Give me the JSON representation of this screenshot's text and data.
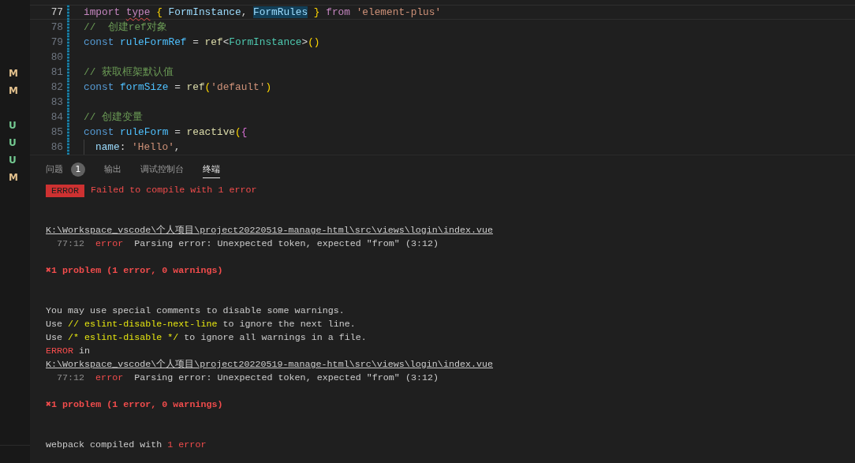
{
  "explorer": {
    "rows": [
      {
        "kind": "modified",
        "letter": "M"
      },
      {
        "kind": "modified",
        "letter": "M"
      },
      {
        "kind": "clean"
      },
      {
        "kind": "untracked",
        "letter": "U"
      },
      {
        "kind": "untracked",
        "letter": "U"
      },
      {
        "kind": "untracked",
        "letter": "U"
      },
      {
        "kind": "modified",
        "letter": "M"
      }
    ]
  },
  "editor": {
    "lines": [
      {
        "number": "77",
        "current": true,
        "changed": true,
        "tokens": [
          {
            "text": "import ",
            "kind": "keyword",
            "squiggle": false,
            "selected": false
          },
          {
            "text": "type",
            "kind": "keyword",
            "squiggle": true,
            "selected": false
          },
          {
            "text": " { ",
            "kind": "bracket",
            "squiggle": false,
            "selected": false
          },
          {
            "text": "FormInstance",
            "kind": "property",
            "squiggle": false,
            "selected": false
          },
          {
            "text": ", ",
            "kind": "plain",
            "squiggle": false,
            "selected": false
          },
          {
            "text": "FormRules",
            "kind": "property",
            "squiggle": false,
            "selected": true
          },
          {
            "text": " } ",
            "kind": "bracket",
            "squiggle": false,
            "selected": false
          },
          {
            "text": "from ",
            "kind": "keyword",
            "squiggle": false,
            "selected": false
          },
          {
            "text": "'element-plus'",
            "kind": "string",
            "squiggle": false,
            "selected": false
          }
        ]
      },
      {
        "number": "78",
        "current": false,
        "changed": true,
        "tokens": [
          {
            "text": "//  创建ref对象",
            "kind": "comment"
          }
        ]
      },
      {
        "number": "79",
        "current": false,
        "changed": true,
        "tokens": [
          {
            "text": "const ",
            "kind": "storage"
          },
          {
            "text": "ruleFormRef",
            "kind": "variable"
          },
          {
            "text": " = ",
            "kind": "plain"
          },
          {
            "text": "ref",
            "kind": "function"
          },
          {
            "text": "<",
            "kind": "plain"
          },
          {
            "text": "FormInstance",
            "kind": "type"
          },
          {
            "text": ">",
            "kind": "plain"
          },
          {
            "text": "()",
            "kind": "bracket"
          }
        ]
      },
      {
        "number": "80",
        "current": false,
        "changed": true
      },
      {
        "number": "81",
        "current": false,
        "changed": true,
        "tokens": [
          {
            "text": "// 获取框架默认值",
            "kind": "comment"
          }
        ]
      },
      {
        "number": "82",
        "current": false,
        "changed": true,
        "tokens": [
          {
            "text": "const ",
            "kind": "storage"
          },
          {
            "text": "formSize",
            "kind": "variable"
          },
          {
            "text": " = ",
            "kind": "plain"
          },
          {
            "text": "ref",
            "kind": "function"
          },
          {
            "text": "(",
            "kind": "bracket"
          },
          {
            "text": "'default'",
            "kind": "string"
          },
          {
            "text": ")",
            "kind": "bracket"
          }
        ]
      },
      {
        "number": "83",
        "current": false,
        "changed": true
      },
      {
        "number": "84",
        "current": false,
        "changed": true,
        "tokens": [
          {
            "text": "// 创建变量",
            "kind": "comment"
          }
        ]
      },
      {
        "number": "85",
        "current": false,
        "changed": true,
        "tokens": [
          {
            "text": "const ",
            "kind": "storage"
          },
          {
            "text": "ruleForm",
            "kind": "variable"
          },
          {
            "text": " = ",
            "kind": "plain"
          },
          {
            "text": "reactive",
            "kind": "function"
          },
          {
            "text": "(",
            "kind": "bracket"
          },
          {
            "text": "{",
            "kind": "bracket-nested"
          }
        ],
        "children": [
          {
            "number": "86",
            "current": false,
            "changed": true,
            "tokens": [
              {
                "text": "name",
                "kind": "property"
              },
              {
                "text": ": ",
                "kind": "plain"
              },
              {
                "text": "'Hello'",
                "kind": "string"
              },
              {
                "text": ",",
                "kind": "plain"
              }
            ]
          }
        ]
      }
    ]
  },
  "panel": {
    "tabs": [
      {
        "label": "问题",
        "selected": false,
        "badge": "1"
      },
      {
        "label": "输出",
        "selected": false
      },
      {
        "label": "调试控制台",
        "selected": false
      },
      {
        "label": "终端",
        "selected": true
      }
    ],
    "terminal": {
      "lines": [
        {
          "kind": "banner",
          "badge": "ERROR",
          "text": "Failed to compile with 1 error"
        },
        {
          "kind": "blank"
        },
        {
          "kind": "blank"
        },
        {
          "kind": "link",
          "text": "K:\\Workspace_vscode\\个人项目\\project20220519-manage-html\\src\\views\\login\\index.vue"
        },
        {
          "kind": "detail",
          "segments": [
            {
              "text": "77:12",
              "kind": "location"
            },
            {
              "text": "  error",
              "kind": "severity"
            },
            {
              "text": "  Parsing error: Unexpected token, expected \"from\" (3:12)",
              "kind": "message"
            }
          ]
        },
        {
          "kind": "blank"
        },
        {
          "kind": "text",
          "segments": [
            {
              "text": "✖1 problem (1 error, 0 warnings)",
              "kind": "summary"
            }
          ]
        },
        {
          "kind": "blank"
        },
        {
          "kind": "blank"
        },
        {
          "kind": "text",
          "segments": [
            {
              "text": "You may use special comments to disable some warnings.",
              "kind": "message"
            }
          ]
        },
        {
          "kind": "text",
          "segments": [
            {
              "text": "Use ",
              "kind": "message"
            },
            {
              "text": "// eslint-disable-next-line",
              "kind": "code"
            },
            {
              "text": " to ignore the next line.",
              "kind": "message"
            }
          ]
        },
        {
          "kind": "text",
          "segments": [
            {
              "text": "Use ",
              "kind": "message"
            },
            {
              "text": "/* eslint-disable */",
              "kind": "code"
            },
            {
              "text": " to ignore all warnings in a file.",
              "kind": "message"
            }
          ]
        },
        {
          "kind": "text",
          "segments": [
            {
              "text": "ERROR",
              "kind": "severity"
            },
            {
              "text": " in",
              "kind": "message"
            }
          ]
        },
        {
          "kind": "link",
          "text": "K:\\Workspace_vscode\\个人项目\\project20220519-manage-html\\src\\views\\login\\index.vue"
        },
        {
          "kind": "detail",
          "segments": [
            {
              "text": "77:12",
              "kind": "location"
            },
            {
              "text": "  error",
              "kind": "severity"
            },
            {
              "text": "  Parsing error: Unexpected token, expected \"from\" (3:12)",
              "kind": "message"
            }
          ]
        },
        {
          "kind": "blank"
        },
        {
          "kind": "text",
          "segments": [
            {
              "text": "✖1 problem (1 error, 0 warnings)",
              "kind": "summary"
            }
          ]
        },
        {
          "kind": "blank"
        },
        {
          "kind": "blank"
        },
        {
          "kind": "text",
          "segments": [
            {
              "text": "webpack compiled with ",
              "kind": "message"
            },
            {
              "text": "1 error",
              "kind": "severity"
            }
          ]
        }
      ]
    }
  }
}
